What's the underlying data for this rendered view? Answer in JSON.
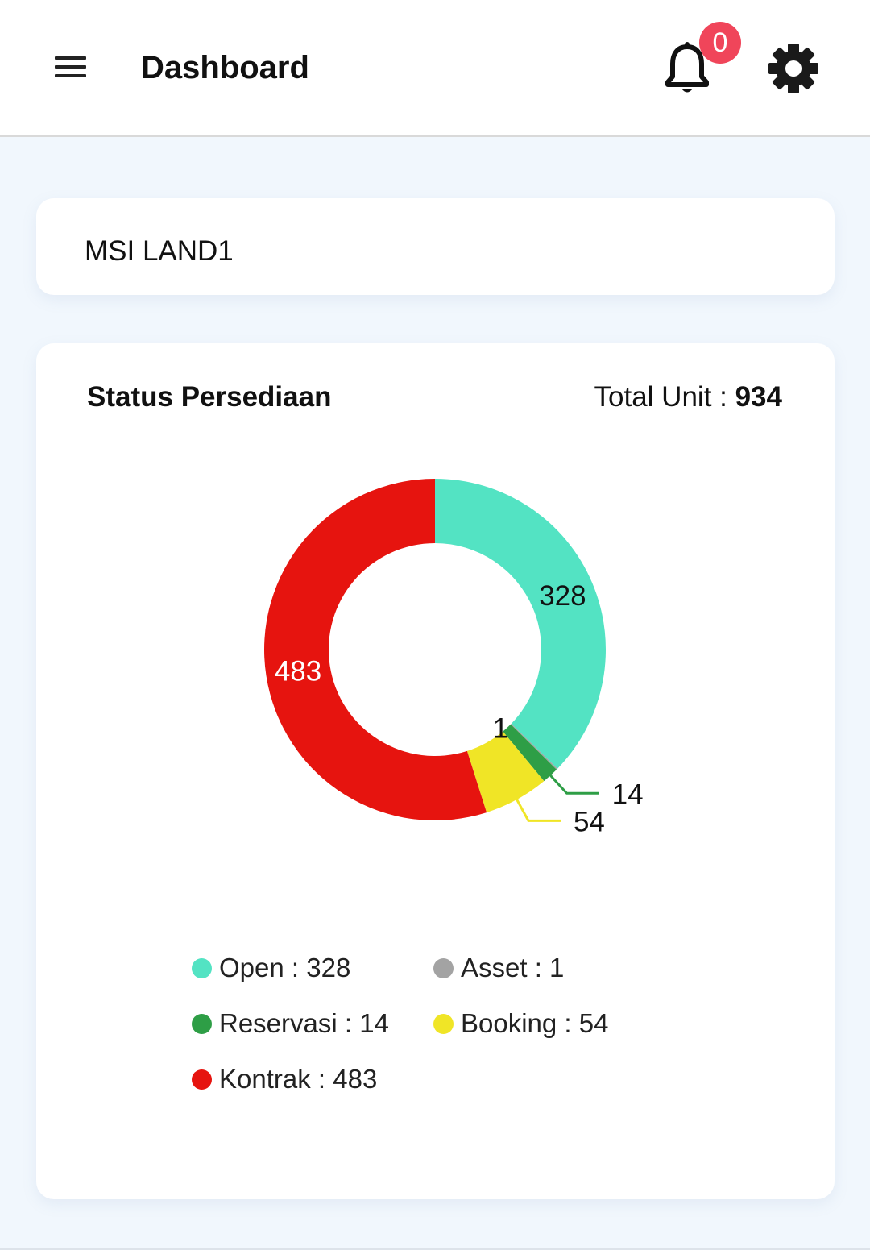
{
  "appbar": {
    "title": "Dashboard",
    "notification_count": "0",
    "icons": [
      "menu-icon",
      "bell-icon",
      "gear-icon"
    ]
  },
  "project": {
    "name": "MSI LAND1"
  },
  "status": {
    "title": "Status Persediaan",
    "total_label": "Total Unit : ",
    "total_value": "934"
  },
  "colors": {
    "open": "#53e3c3",
    "asset": "#a3a3a3",
    "reservasi": "#2e9e46",
    "booking": "#f0e526",
    "kontrak": "#e6140f",
    "badge": "#f0455a"
  },
  "chart_data": {
    "type": "pie",
    "style": "donut",
    "title": "Status Persediaan",
    "total": 934,
    "categories": [
      "Open",
      "Asset",
      "Reservasi",
      "Booking",
      "Kontrak"
    ],
    "values": [
      328,
      1,
      14,
      54,
      483
    ],
    "slice_labels": [
      "328",
      "1",
      "14",
      "54",
      "483"
    ]
  },
  "legend": [
    {
      "label": "Open : 328",
      "color": "#53e3c3"
    },
    {
      "label": "Asset : 1",
      "color": "#a3a3a3"
    },
    {
      "label": "Reservasi : 14",
      "color": "#2e9e46"
    },
    {
      "label": "Booking : 54",
      "color": "#f0e526"
    },
    {
      "label": "Kontrak : 483",
      "color": "#e6140f"
    }
  ]
}
